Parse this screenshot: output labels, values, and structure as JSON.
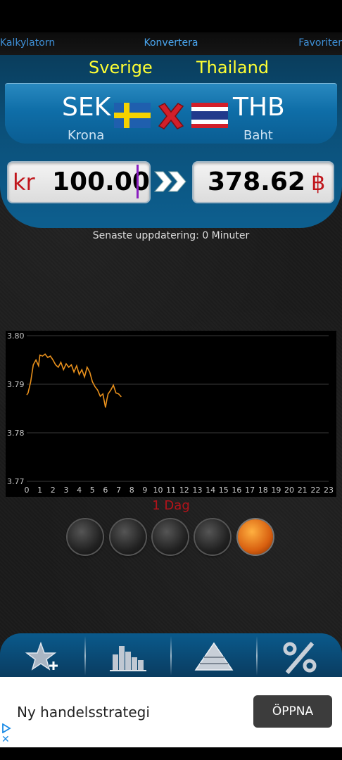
{
  "nav": {
    "left": "Kalkylatorn",
    "center": "Konvertera",
    "right": "Favoriter"
  },
  "converter": {
    "from": {
      "country": "Sverige",
      "code": "SEK",
      "name": "Krona",
      "symbol": "kr",
      "amount": "100.00"
    },
    "to": {
      "country": "Thailand",
      "code": "THB",
      "name": "Baht",
      "symbol": "฿",
      "amount": "378.62"
    }
  },
  "updated": "Senaste uppdatering: 0 Minuter",
  "chart_data": {
    "type": "line",
    "ylim": [
      3.77,
      3.8
    ],
    "yticks": [
      "3.80",
      "3.79",
      "3.78",
      "3.77"
    ],
    "xlim": [
      0,
      23
    ],
    "xticks": [
      "0",
      "1",
      "2",
      "3",
      "4",
      "5",
      "6",
      "7",
      "8",
      "9",
      "10",
      "11",
      "12",
      "13",
      "14",
      "15",
      "16",
      "17",
      "18",
      "19",
      "20",
      "21",
      "22",
      "23"
    ],
    "grid": true,
    "series": [
      {
        "color": "#e8901c",
        "x": [
          0,
          0.1,
          0.3,
          0.5,
          0.7,
          0.9,
          1.0,
          1.2,
          1.4,
          1.6,
          1.8,
          2.0,
          2.2,
          2.4,
          2.6,
          2.8,
          3.0,
          3.2,
          3.4,
          3.6,
          3.8,
          4.0,
          4.2,
          4.4,
          4.6,
          4.8,
          5.0,
          5.2,
          5.4,
          5.6,
          5.8,
          6.0,
          6.1,
          6.2,
          6.4,
          6.6,
          6.8,
          7.0,
          7.2
        ],
        "y": [
          3.7878,
          3.7882,
          3.7905,
          3.794,
          3.795,
          3.7938,
          3.796,
          3.7958,
          3.7962,
          3.7955,
          3.7958,
          3.795,
          3.794,
          3.7935,
          3.7945,
          3.793,
          3.7942,
          3.7935,
          3.794,
          3.7925,
          3.7938,
          3.792,
          3.793,
          3.7915,
          3.7935,
          3.7925,
          3.7905,
          3.7895,
          3.7888,
          3.7875,
          3.788,
          3.7852,
          3.7868,
          3.788,
          3.7888,
          3.7898,
          3.7882,
          3.788,
          3.7874
        ]
      }
    ]
  },
  "chart_period": "1 Dag",
  "period_options_count": 5,
  "active_period_index": 4,
  "ad": {
    "text": "Ny handelsstrategi",
    "button": "ÖPPNA"
  }
}
